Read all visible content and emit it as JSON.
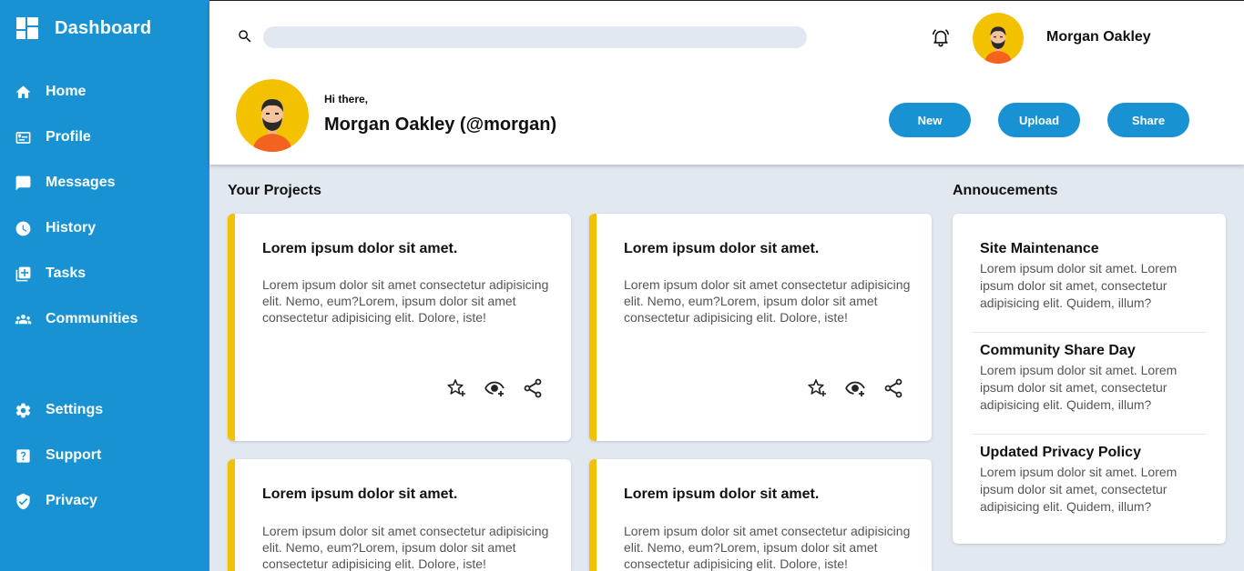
{
  "sidebar": {
    "brand": "Dashboard",
    "items": [
      {
        "label": "Home",
        "icon": "home-icon"
      },
      {
        "label": "Profile",
        "icon": "profile-card-icon"
      },
      {
        "label": "Messages",
        "icon": "message-icon"
      },
      {
        "label": "History",
        "icon": "clock-icon"
      },
      {
        "label": "Tasks",
        "icon": "documents-icon"
      },
      {
        "label": "Communities",
        "icon": "group-icon"
      }
    ],
    "bottom_items": [
      {
        "label": "Settings",
        "icon": "gear-icon"
      },
      {
        "label": "Support",
        "icon": "help-icon"
      },
      {
        "label": "Privacy",
        "icon": "shield-icon"
      }
    ],
    "color": "#1992d4"
  },
  "header": {
    "search_value": "",
    "user_name": "Morgan Oakley",
    "greeting": "Hi there,",
    "full_name": "Morgan Oakley (@morgan)",
    "buttons": {
      "new": "New",
      "upload": "Upload",
      "share": "Share"
    }
  },
  "projects": {
    "title": "Your Projects",
    "accent": "#f2c200",
    "cards": [
      {
        "title": "Lorem ipsum dolor sit amet.",
        "text": "Lorem ipsum dolor sit amet consectetur adipisicing elit. Nemo, eum?Lorem, ipsum dolor sit amet consectetur adipisicing elit. Dolore, iste!"
      },
      {
        "title": "Lorem ipsum dolor sit amet.",
        "text": "Lorem ipsum dolor sit amet consectetur adipisicing elit. Nemo, eum?Lorem, ipsum dolor sit amet consectetur adipisicing elit. Dolore, iste!"
      },
      {
        "title": "Lorem ipsum dolor sit amet.",
        "text": "Lorem ipsum dolor sit amet consectetur adipisicing elit. Nemo, eum?Lorem, ipsum dolor sit amet consectetur adipisicing elit. Dolore, iste!"
      },
      {
        "title": "Lorem ipsum dolor sit amet.",
        "text": "Lorem ipsum dolor sit amet consectetur adipisicing elit. Nemo, eum?Lorem, ipsum dolor sit amet consectetur adipisicing elit. Dolore, iste!"
      }
    ]
  },
  "announcements": {
    "title": "Annoucements",
    "items": [
      {
        "title": "Site Maintenance",
        "text": "Lorem ipsum dolor sit amet. Lorem ipsum dolor sit amet, consectetur adipisicing elit. Quidem, illum?"
      },
      {
        "title": "Community Share Day",
        "text": "Lorem ipsum dolor sit amet. Lorem ipsum dolor sit amet, consectetur adipisicing elit. Quidem, illum?"
      },
      {
        "title": "Updated Privacy Policy",
        "text": "Lorem ipsum dolor sit amet. Lorem ipsum dolor sit amet, consectetur adipisicing elit. Quidem, illum?"
      }
    ]
  }
}
